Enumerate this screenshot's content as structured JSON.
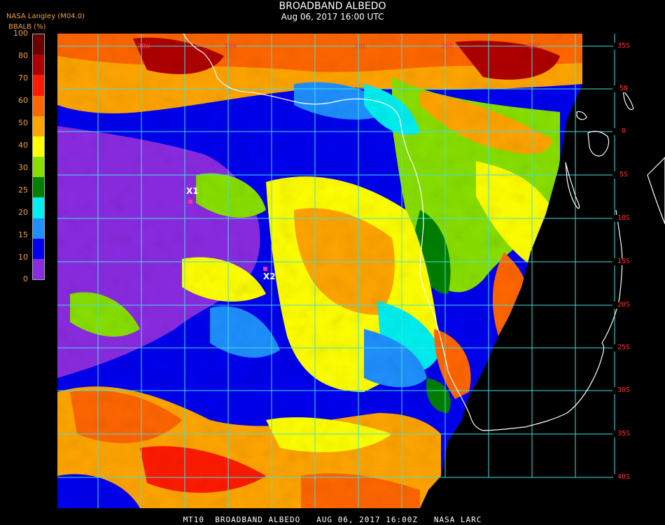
{
  "header": {
    "title": "BROADBAND ALBEDO",
    "subtitle": "Aug 06, 2017 16:00 UTC",
    "source": "NASA Langley (M04.0)",
    "colorbar_label": "BBALB (%)"
  },
  "colorbar": {
    "ticks": [
      "100",
      "80",
      "70",
      "60",
      "50",
      "40",
      "30",
      "25",
      "20",
      "15",
      "10",
      "0"
    ],
    "colors": [
      "#6a0000",
      "#b00000",
      "#ff1a00",
      "#ff6600",
      "#ffa500",
      "#ffff00",
      "#88e000",
      "#008000",
      "#00f0f0",
      "#1e90ff",
      "#0000ee",
      "#8a2be2"
    ]
  },
  "map": {
    "lat_labels": [
      "35S",
      "5N",
      "0",
      "5S",
      "10S",
      "15S",
      "20S",
      "25S",
      "30S",
      "35S",
      "40S"
    ],
    "lon_labels": [
      "20W",
      "10W",
      "10E",
      "20E",
      "30E"
    ],
    "markers": [
      {
        "label": "X1"
      },
      {
        "label": "X2"
      }
    ],
    "grid_color": "#40e0e0",
    "coast_color": "#ffffff"
  },
  "footer": {
    "text": "MT10  BROADBAND ALBEDO   AUG 06, 2017 16:00Z   NASA LARC"
  }
}
